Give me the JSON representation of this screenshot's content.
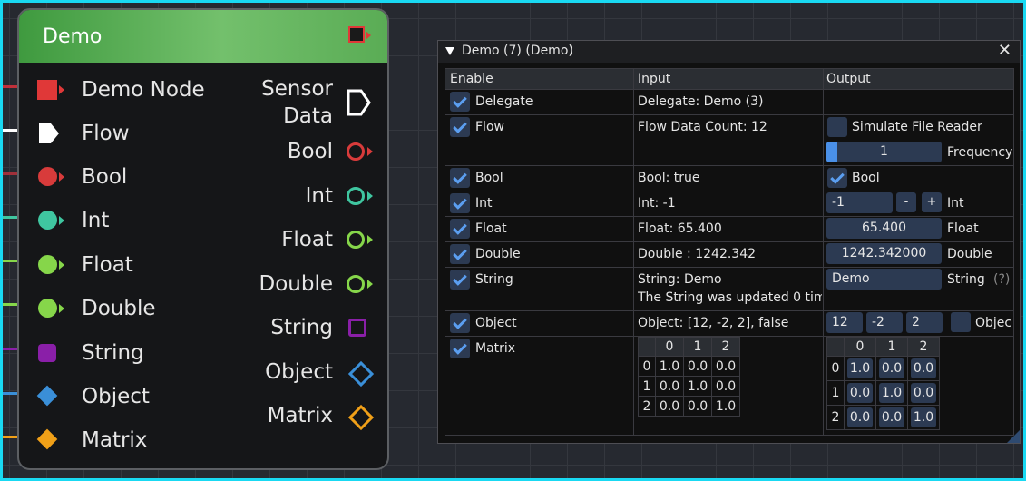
{
  "node": {
    "title": "Demo",
    "inputs": [
      {
        "label": "Demo Node",
        "icon": "square-exec-icon",
        "color": "#e03838"
      },
      {
        "label": "Flow",
        "icon": "flow-icon",
        "color": "#ffffff"
      },
      {
        "label": "Bool",
        "icon": "circle-pin-icon",
        "color": "#d83b3b"
      },
      {
        "label": "Int",
        "icon": "circle-pin-icon",
        "color": "#3fc6a0"
      },
      {
        "label": "Float",
        "icon": "circle-pin-icon",
        "color": "#86d64a"
      },
      {
        "label": "Double",
        "icon": "circle-pin-icon",
        "color": "#86d64a"
      },
      {
        "label": "String",
        "icon": "square-pin-icon",
        "color": "#8a1fa8"
      },
      {
        "label": "Object",
        "icon": "diamond-pin-icon",
        "color": "#3a8fd8"
      },
      {
        "label": "Matrix",
        "icon": "diamond-pin-icon",
        "color": "#f0a018"
      }
    ],
    "outputs": [
      {
        "label_line1": "Sensor",
        "label_line2": "Data",
        "icon": "flow-outline-icon",
        "color": "#ffffff"
      },
      {
        "label": "Bool",
        "icon": "circle-outline-icon",
        "color": "#d83b3b"
      },
      {
        "label": "Int",
        "icon": "circle-outline-icon",
        "color": "#3fc6a0"
      },
      {
        "label": "Float",
        "icon": "circle-outline-icon",
        "color": "#86d64a"
      },
      {
        "label": "Double",
        "icon": "circle-outline-icon",
        "color": "#86d64a"
      },
      {
        "label": "String",
        "icon": "square-outline-icon",
        "color": "#8a1fa8"
      },
      {
        "label": "Object",
        "icon": "diamond-outline-icon",
        "color": "#3a8fd8"
      },
      {
        "label": "Matrix",
        "icon": "diamond-outline-icon",
        "color": "#f0a018"
      }
    ]
  },
  "window": {
    "title": "Demo (7) (Demo)",
    "close": "✕",
    "headers": {
      "enable": "Enable",
      "input": "Input",
      "output": "Output"
    },
    "rows": {
      "delegate": {
        "label": "Delegate",
        "input": "Delegate: Demo (3)"
      },
      "flow": {
        "label": "Flow",
        "input": "Flow Data Count: 12",
        "simulate_label": "Simulate File Reader",
        "frequency_value": "1",
        "frequency_label": "Frequency"
      },
      "bool": {
        "label": "Bool",
        "input": "Bool: true",
        "out_label": "Bool"
      },
      "int": {
        "label": "Int",
        "input": "Int: -1",
        "value": "-1",
        "minus": "-",
        "plus": "+",
        "out_label": "Int"
      },
      "float": {
        "label": "Float",
        "input": "Float: 65.400",
        "value": "65.400",
        "out_label": "Float"
      },
      "double": {
        "label": "Double",
        "input": "Double : 1242.342",
        "value": "1242.342000",
        "out_label": "Double"
      },
      "string": {
        "label": "String",
        "input": "String: Demo",
        "input2": "The String was updated 0 tim",
        "value": "Demo",
        "out_label": "String",
        "help": "(?)"
      },
      "object": {
        "label": "Object",
        "input": "Object: [12, -2, 2], false",
        "v1": "12",
        "v2": "-2",
        "v3": "2",
        "out_label": "Objec"
      },
      "matrix": {
        "label": "Matrix"
      }
    },
    "matrix_input": {
      "col_headers": [
        "0",
        "1",
        "2"
      ],
      "rows": [
        [
          "0",
          "1.0",
          "0.0",
          "0.0"
        ],
        [
          "1",
          "0.0",
          "1.0",
          "0.0"
        ],
        [
          "2",
          "0.0",
          "0.0",
          "1.0"
        ]
      ]
    },
    "matrix_output": {
      "col_headers": [
        "0",
        "1",
        "2"
      ],
      "rows": [
        [
          "0",
          "1.0",
          "0.0",
          "0.0"
        ],
        [
          "1",
          "0.0",
          "1.0",
          "0.0"
        ],
        [
          "2",
          "0.0",
          "0.0",
          "1.0"
        ]
      ]
    }
  }
}
